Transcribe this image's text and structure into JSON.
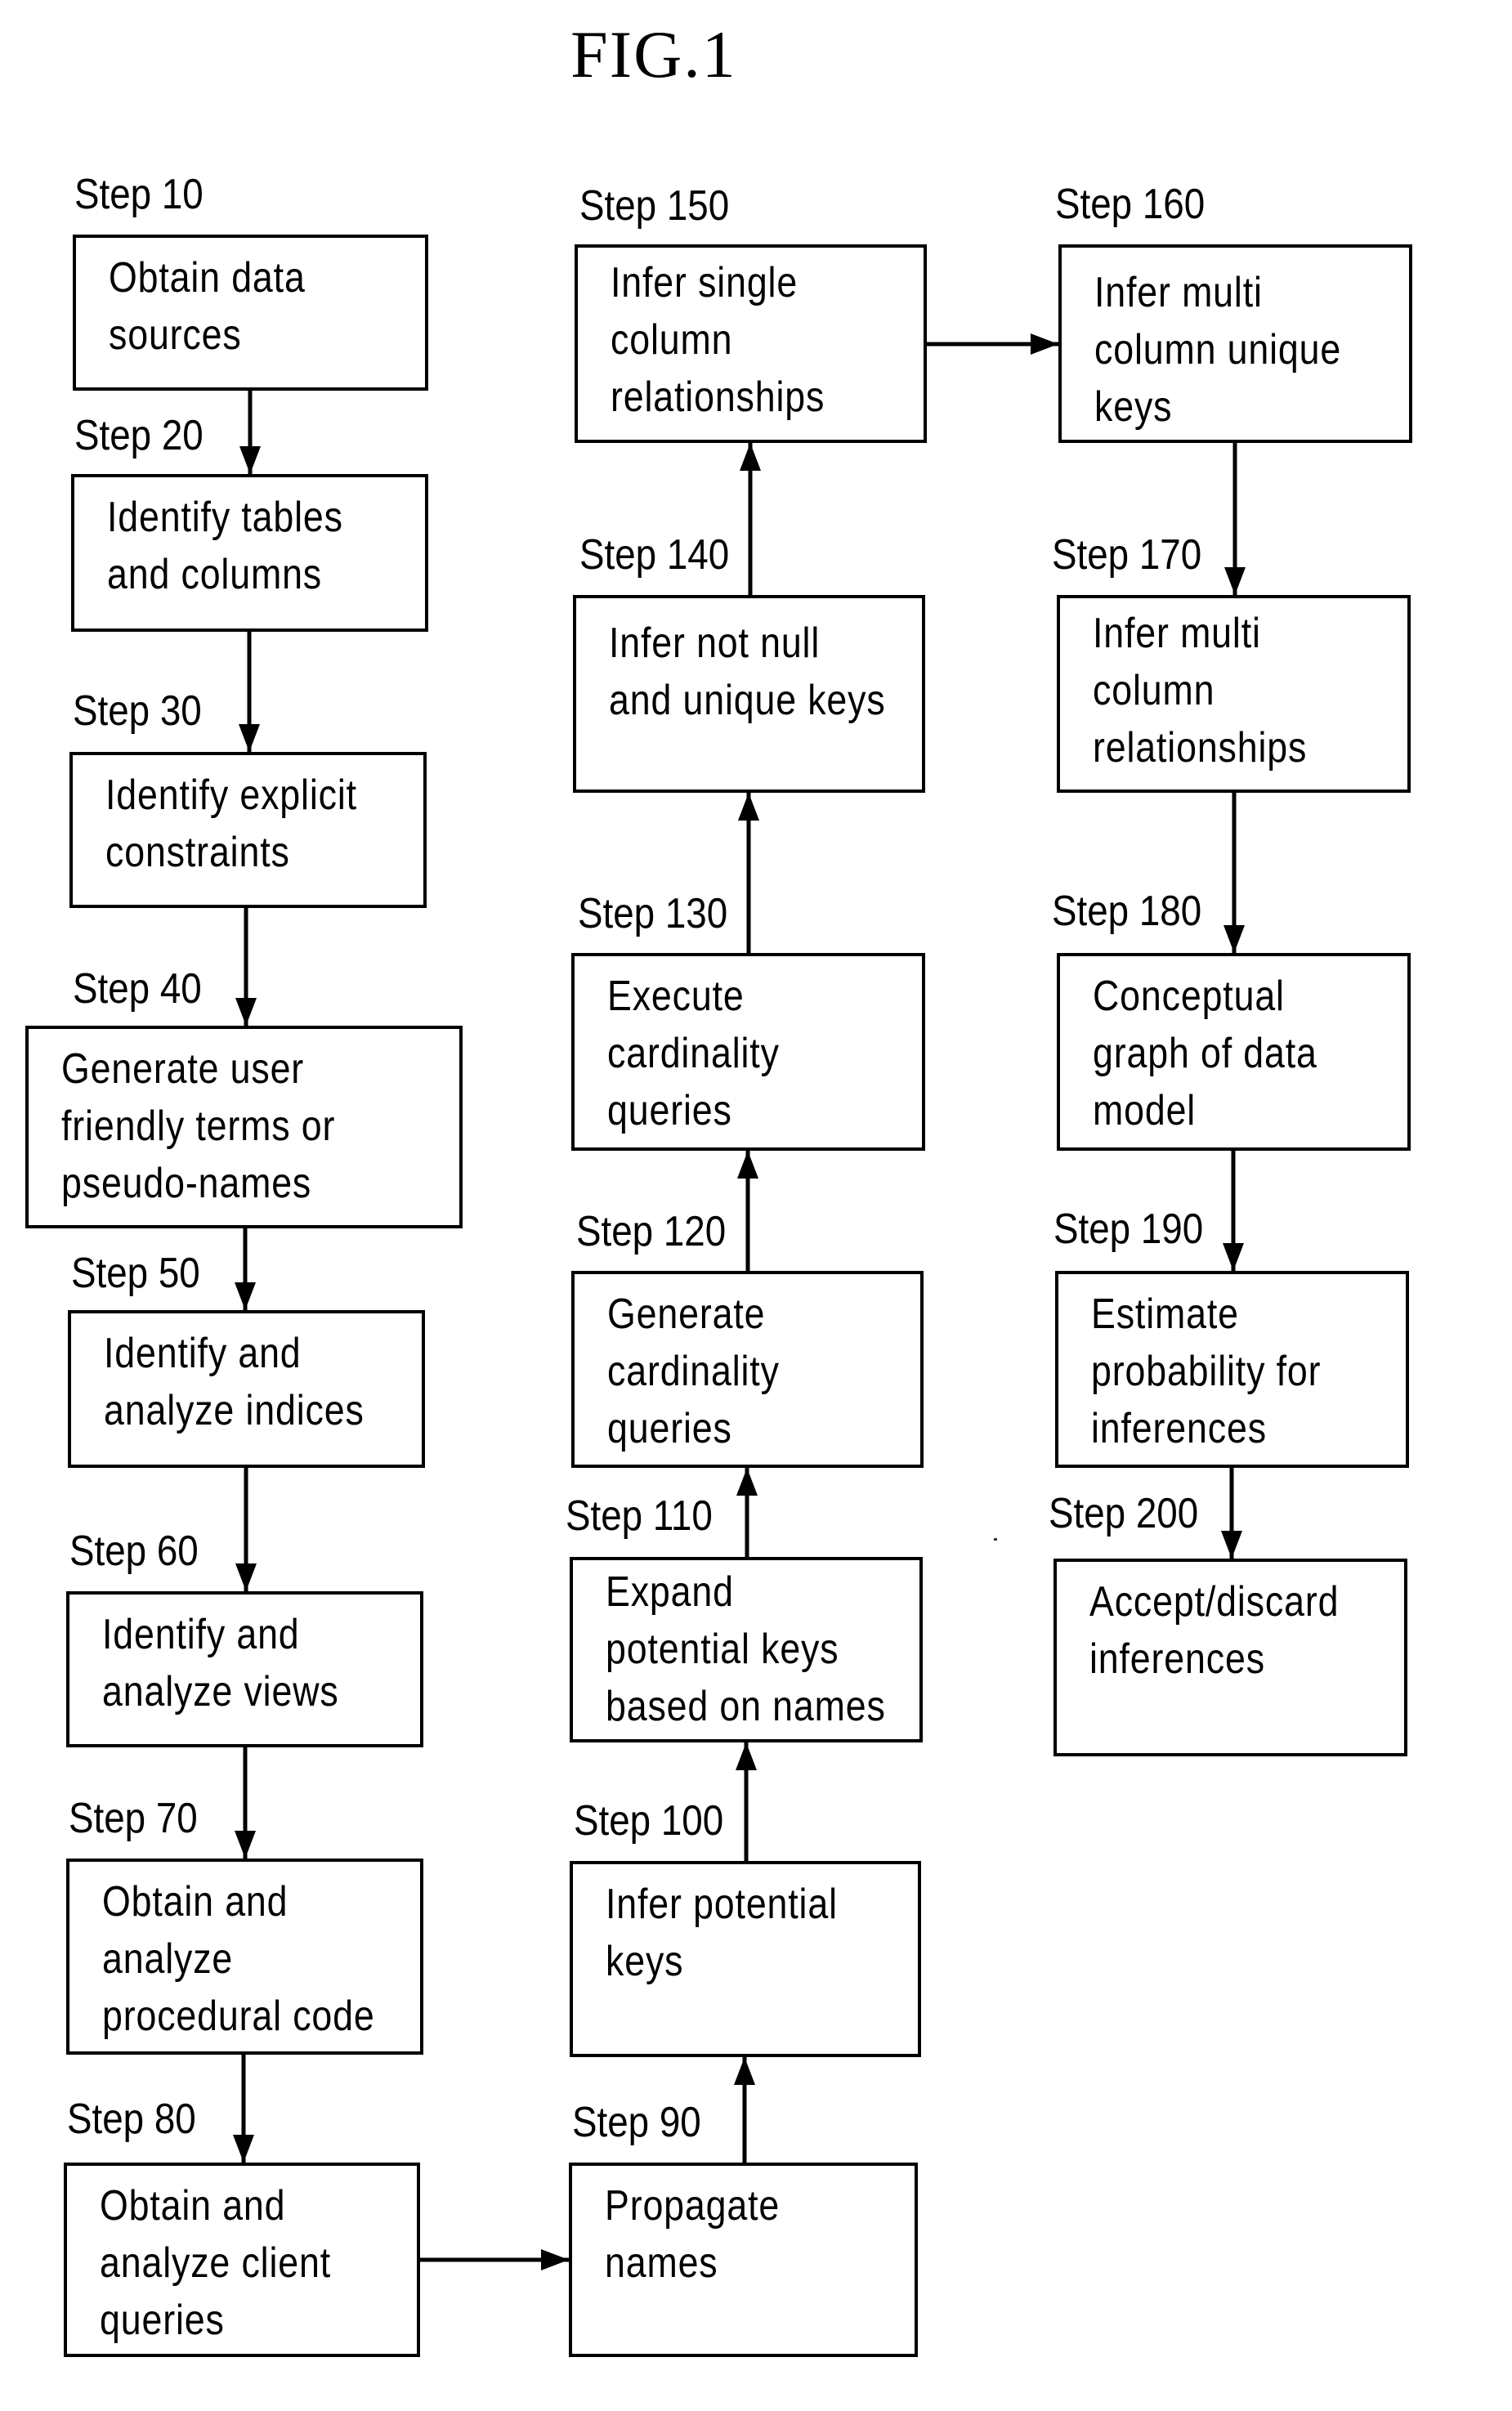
{
  "figure": {
    "title": "FIG.1"
  },
  "steps": [
    {
      "id": "10",
      "label": "Step 10",
      "text": "Obtain data\nsources"
    },
    {
      "id": "20",
      "label": "Step 20",
      "text": "Identify tables\nand columns"
    },
    {
      "id": "30",
      "label": "Step 30",
      "text": "Identify explicit\nconstraints"
    },
    {
      "id": "40",
      "label": "Step 40",
      "text": "Generate user\nfriendly terms or\npseudo-names"
    },
    {
      "id": "50",
      "label": "Step 50",
      "text": "Identify and\nanalyze indices"
    },
    {
      "id": "60",
      "label": "Step 60",
      "text": "Identify and\nanalyze views"
    },
    {
      "id": "70",
      "label": "Step 70",
      "text": "Obtain and\nanalyze\nprocedural code"
    },
    {
      "id": "80",
      "label": "Step 80",
      "text": "Obtain and\nanalyze client\nqueries"
    },
    {
      "id": "90",
      "label": "Step 90",
      "text": "Propagate\nnames"
    },
    {
      "id": "100",
      "label": "Step 100",
      "text": "Infer potential\nkeys"
    },
    {
      "id": "110",
      "label": "Step 110",
      "text": "Expand\npotential keys\nbased on names"
    },
    {
      "id": "120",
      "label": "Step 120",
      "text": "Generate\ncardinality\nqueries"
    },
    {
      "id": "130",
      "label": "Step 130",
      "text": "Execute\ncardinality\nqueries"
    },
    {
      "id": "140",
      "label": "Step 140",
      "text": "Infer not null\nand unique keys"
    },
    {
      "id": "150",
      "label": "Step 150",
      "text": "Infer single\ncolumn\nrelationships"
    },
    {
      "id": "160",
      "label": "Step 160",
      "text": "Infer multi\ncolumn unique\nkeys"
    },
    {
      "id": "170",
      "label": "Step 170",
      "text": "Infer multi\ncolumn\nrelationships"
    },
    {
      "id": "180",
      "label": "Step 180",
      "text": "Conceptual\ngraph of data\nmodel"
    },
    {
      "id": "190",
      "label": "Step 190",
      "text": "Estimate\nprobability for\ninferences"
    },
    {
      "id": "200",
      "label": "Step 200",
      "text": "Accept/discard\ninferences"
    }
  ],
  "edges": [
    {
      "from": "10",
      "to": "20"
    },
    {
      "from": "20",
      "to": "30"
    },
    {
      "from": "30",
      "to": "40"
    },
    {
      "from": "40",
      "to": "50"
    },
    {
      "from": "50",
      "to": "60"
    },
    {
      "from": "60",
      "to": "70"
    },
    {
      "from": "70",
      "to": "80"
    },
    {
      "from": "80",
      "to": "90"
    },
    {
      "from": "90",
      "to": "100"
    },
    {
      "from": "100",
      "to": "110"
    },
    {
      "from": "110",
      "to": "120"
    },
    {
      "from": "120",
      "to": "130"
    },
    {
      "from": "130",
      "to": "140"
    },
    {
      "from": "140",
      "to": "150"
    },
    {
      "from": "150",
      "to": "160"
    },
    {
      "from": "160",
      "to": "170"
    },
    {
      "from": "170",
      "to": "180"
    },
    {
      "from": "180",
      "to": "190"
    },
    {
      "from": "190",
      "to": "200"
    }
  ]
}
